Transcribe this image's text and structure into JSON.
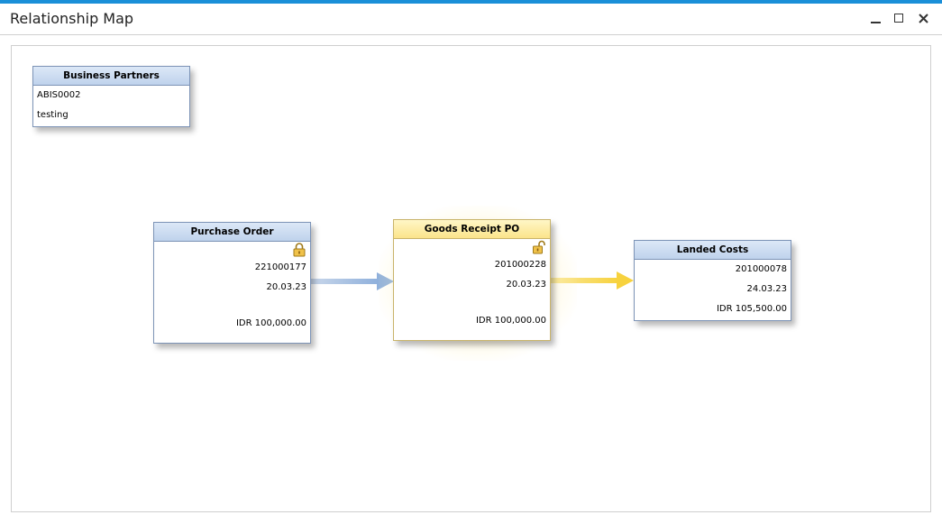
{
  "window": {
    "title": "Relationship Map",
    "accent_color": "#1a8fd8"
  },
  "nodes": {
    "business_partners": {
      "header": "Business Partners",
      "code": "ABIS0002",
      "name": "testing"
    },
    "purchase_order": {
      "header": "Purchase Order",
      "icon": "lock-closed-icon",
      "doc_number": "221000177",
      "date": "20.03.23",
      "total": "IDR 100,000.00"
    },
    "goods_receipt_po": {
      "header": "Goods Receipt PO",
      "icon": "lock-open-icon",
      "doc_number": "201000228",
      "date": "20.03.23",
      "total": "IDR 100,000.00",
      "highlight_color": "#fbe48a"
    },
    "landed_costs": {
      "header": "Landed Costs",
      "doc_number": "201000078",
      "date": "24.03.23",
      "total": "IDR 105,500.00"
    }
  },
  "links": [
    {
      "from": "purchase_order",
      "to": "goods_receipt_po",
      "color": "#8fb0dc"
    },
    {
      "from": "goods_receipt_po",
      "to": "landed_costs",
      "color": "#f7d23e"
    }
  ]
}
